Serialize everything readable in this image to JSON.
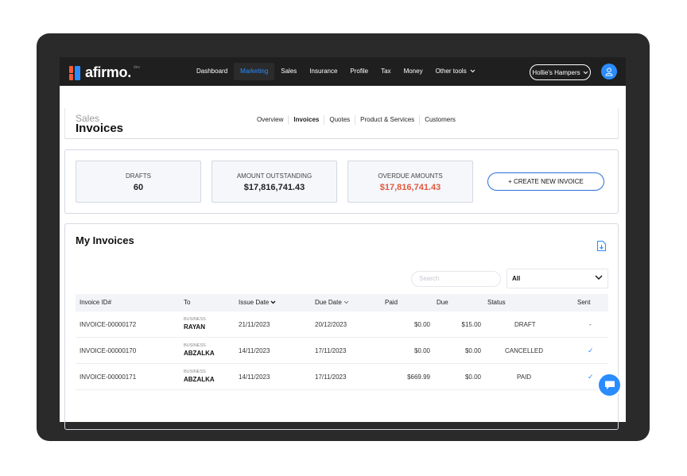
{
  "brand": {
    "name": "afirmo.",
    "tag": "dev"
  },
  "nav": {
    "items": [
      {
        "label": "Dashboard",
        "active": false
      },
      {
        "label": "Marketing",
        "active": true
      },
      {
        "label": "Sales",
        "active": false
      },
      {
        "label": "Insurance",
        "active": false
      },
      {
        "label": "Profile",
        "active": false
      },
      {
        "label": "Tax",
        "active": false
      },
      {
        "label": "Money",
        "active": false
      },
      {
        "label": "Other tools",
        "active": false,
        "dropdown": true
      }
    ]
  },
  "account": {
    "label": "Hollie's Hampers",
    "icon": "chevron-down-icon"
  },
  "user": {
    "icon": "user-icon",
    "color": "#2a8cff"
  },
  "page": {
    "section": "Sales",
    "title": "Invoices"
  },
  "subnav": {
    "items": [
      {
        "label": "Overview",
        "active": false
      },
      {
        "label": "Invoices",
        "active": true
      },
      {
        "label": "Quotes",
        "active": false
      },
      {
        "label": "Product & Services",
        "active": false
      },
      {
        "label": "Customers",
        "active": false
      }
    ]
  },
  "stats": {
    "drafts": {
      "label": "DRAFTS",
      "value": "60"
    },
    "outstanding": {
      "label": "AMOUNT OUTSTANDING",
      "value": "$17,816,741.43"
    },
    "overdue": {
      "label": "OVERDUE AMOUNTS",
      "value": "$17,816,741.43",
      "color": "#e2583e"
    }
  },
  "create_button": "+ CREATE NEW INVOICE",
  "invoices": {
    "title": "My Invoices",
    "search_placeholder": "Search",
    "filter_value": "All",
    "columns": {
      "id": "Invoice ID#",
      "to": "To",
      "issue": "Issue Date",
      "due_date": "Due Date",
      "paid": "Paid",
      "due": "Due",
      "status": "Status",
      "sent": "Sent"
    },
    "rows": [
      {
        "id": "INVOICE-00000172",
        "to_type": "BUSINESS",
        "to_name": "RAYAN",
        "issue": "21/11/2023",
        "due_date": "20/12/2023",
        "paid": "$0.00",
        "due": "$15.00",
        "status": "DRAFT",
        "sent": "-"
      },
      {
        "id": "INVOICE-00000170",
        "to_type": "BUSINESS",
        "to_name": "ABZALKA",
        "issue": "14/11/2023",
        "due_date": "17/11/2023",
        "paid": "$0.00",
        "due": "$0.00",
        "status": "CANCELLED",
        "sent": "✓"
      },
      {
        "id": "INVOICE-00000171",
        "to_type": "BUSINESS",
        "to_name": "ABZALKA",
        "issue": "14/11/2023",
        "due_date": "17/11/2023",
        "paid": "$669.99",
        "due": "$0.00",
        "status": "PAID",
        "sent": "✓"
      }
    ]
  },
  "chat": {
    "icon": "chat-icon"
  }
}
